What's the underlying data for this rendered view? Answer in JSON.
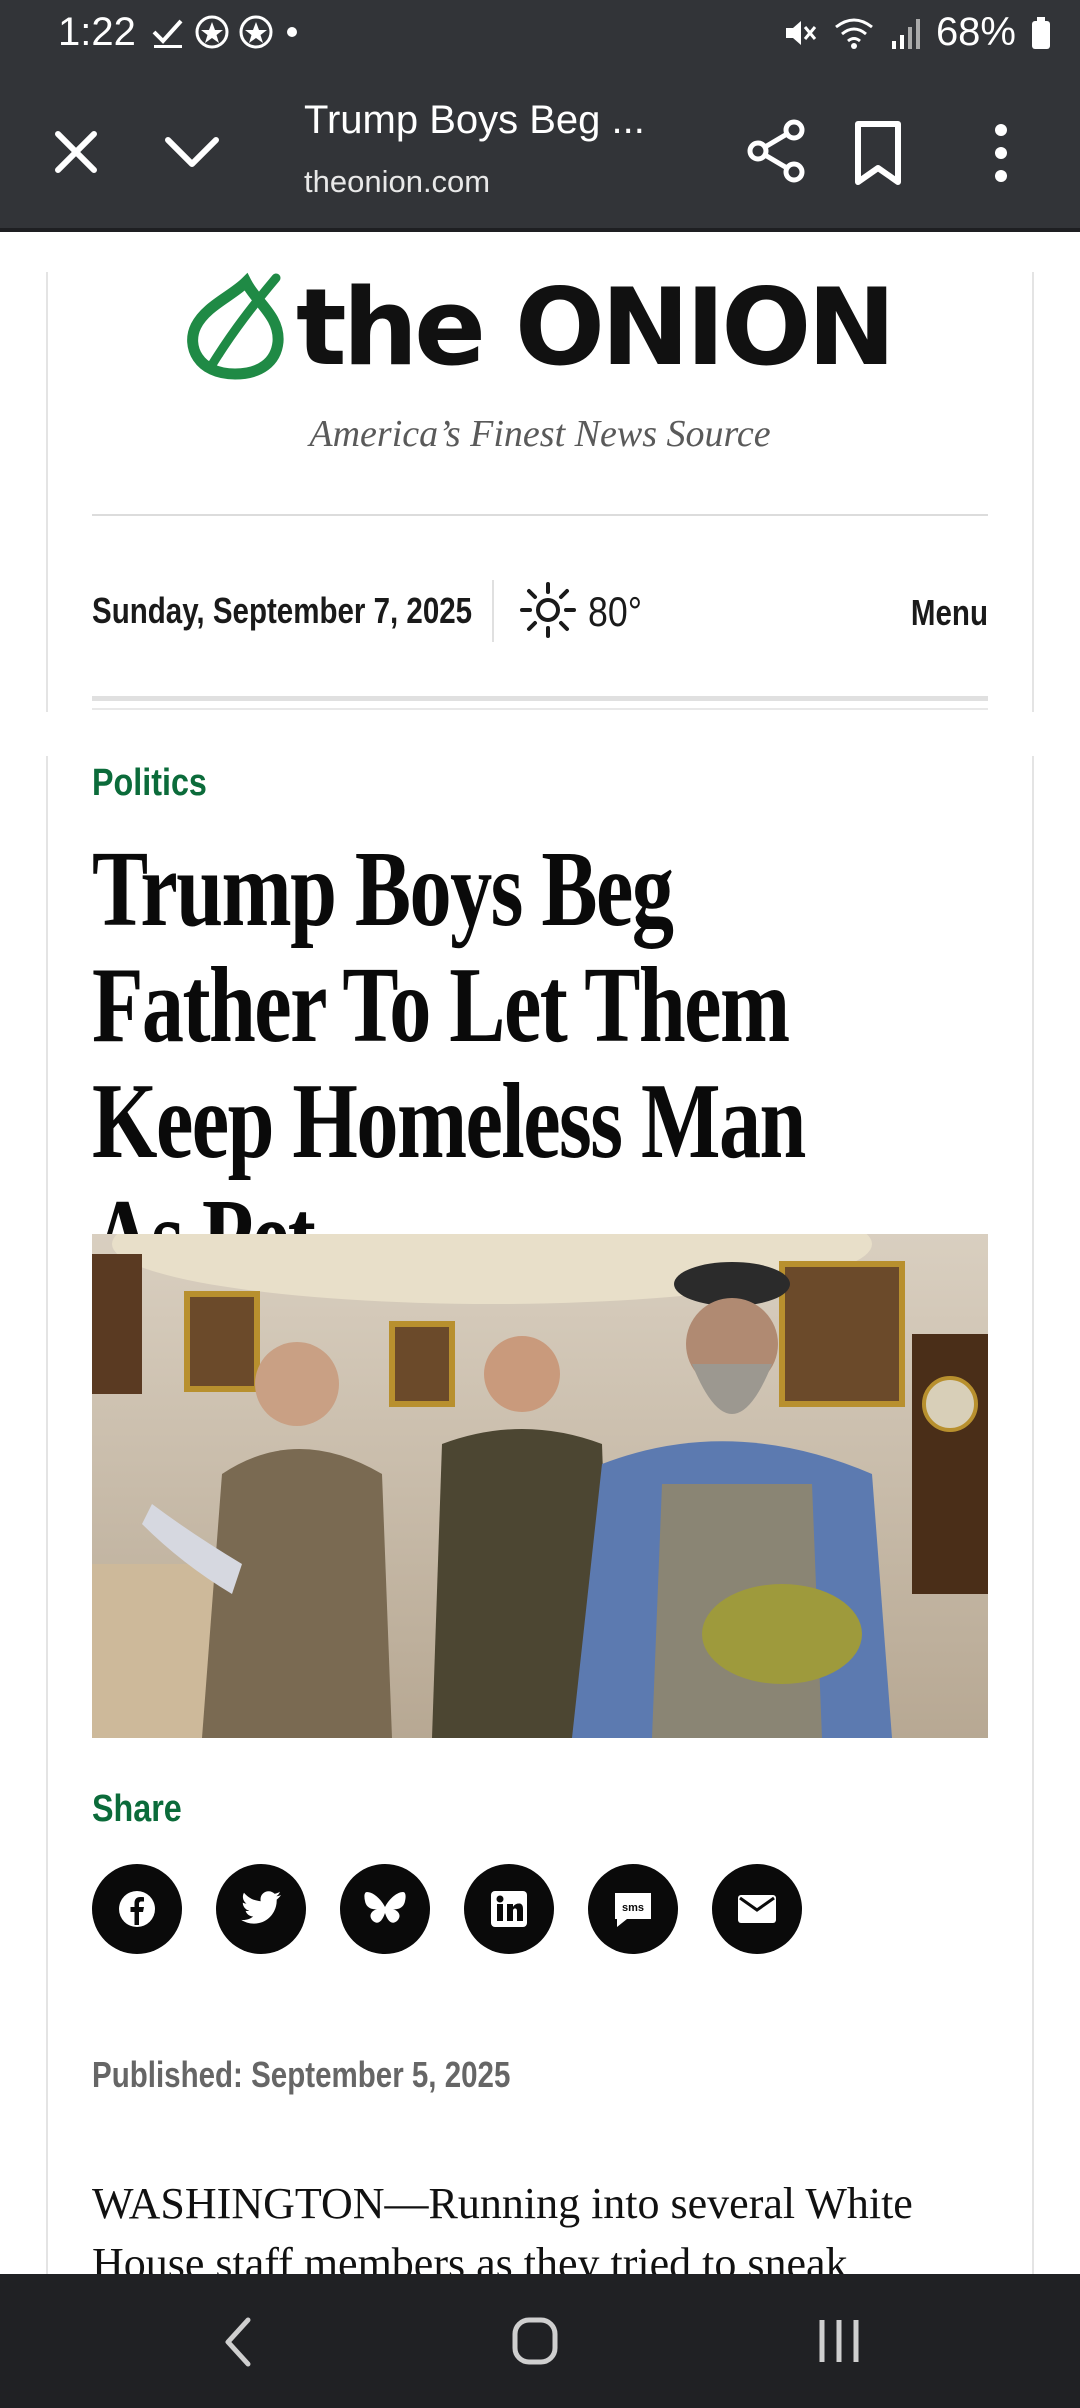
{
  "status_bar": {
    "time": "1:22",
    "battery": "68%"
  },
  "tab_bar": {
    "title": "Trump Boys Beg ...",
    "url": "theonion.com"
  },
  "masthead": {
    "logo_text": "the ONION",
    "tagline": "America’s Finest News Source"
  },
  "date_row": {
    "date": "Sunday, September 7, 2025",
    "temperature": "80°",
    "menu_label": "Menu"
  },
  "article": {
    "category": "Politics",
    "headline": "Trump Boys Beg Father To Let Them Keep Homeless Man As Pet",
    "share_label": "Share",
    "published_label": "Published:",
    "published_date": "September 5, 2025",
    "body_preview": "WASHINGTON—Running into several White House staff members as they tried to sneak"
  },
  "share_buttons": [
    {
      "icon": "facebook-icon"
    },
    {
      "icon": "twitter-icon"
    },
    {
      "icon": "bluesky-icon"
    },
    {
      "icon": "linkedin-icon"
    },
    {
      "icon": "sms-icon",
      "label": "sms"
    },
    {
      "icon": "email-icon"
    }
  ],
  "colors": {
    "chrome_bar": "#323438",
    "onion_green": "#0b6b3a",
    "logo_green": "#1f8a45"
  }
}
